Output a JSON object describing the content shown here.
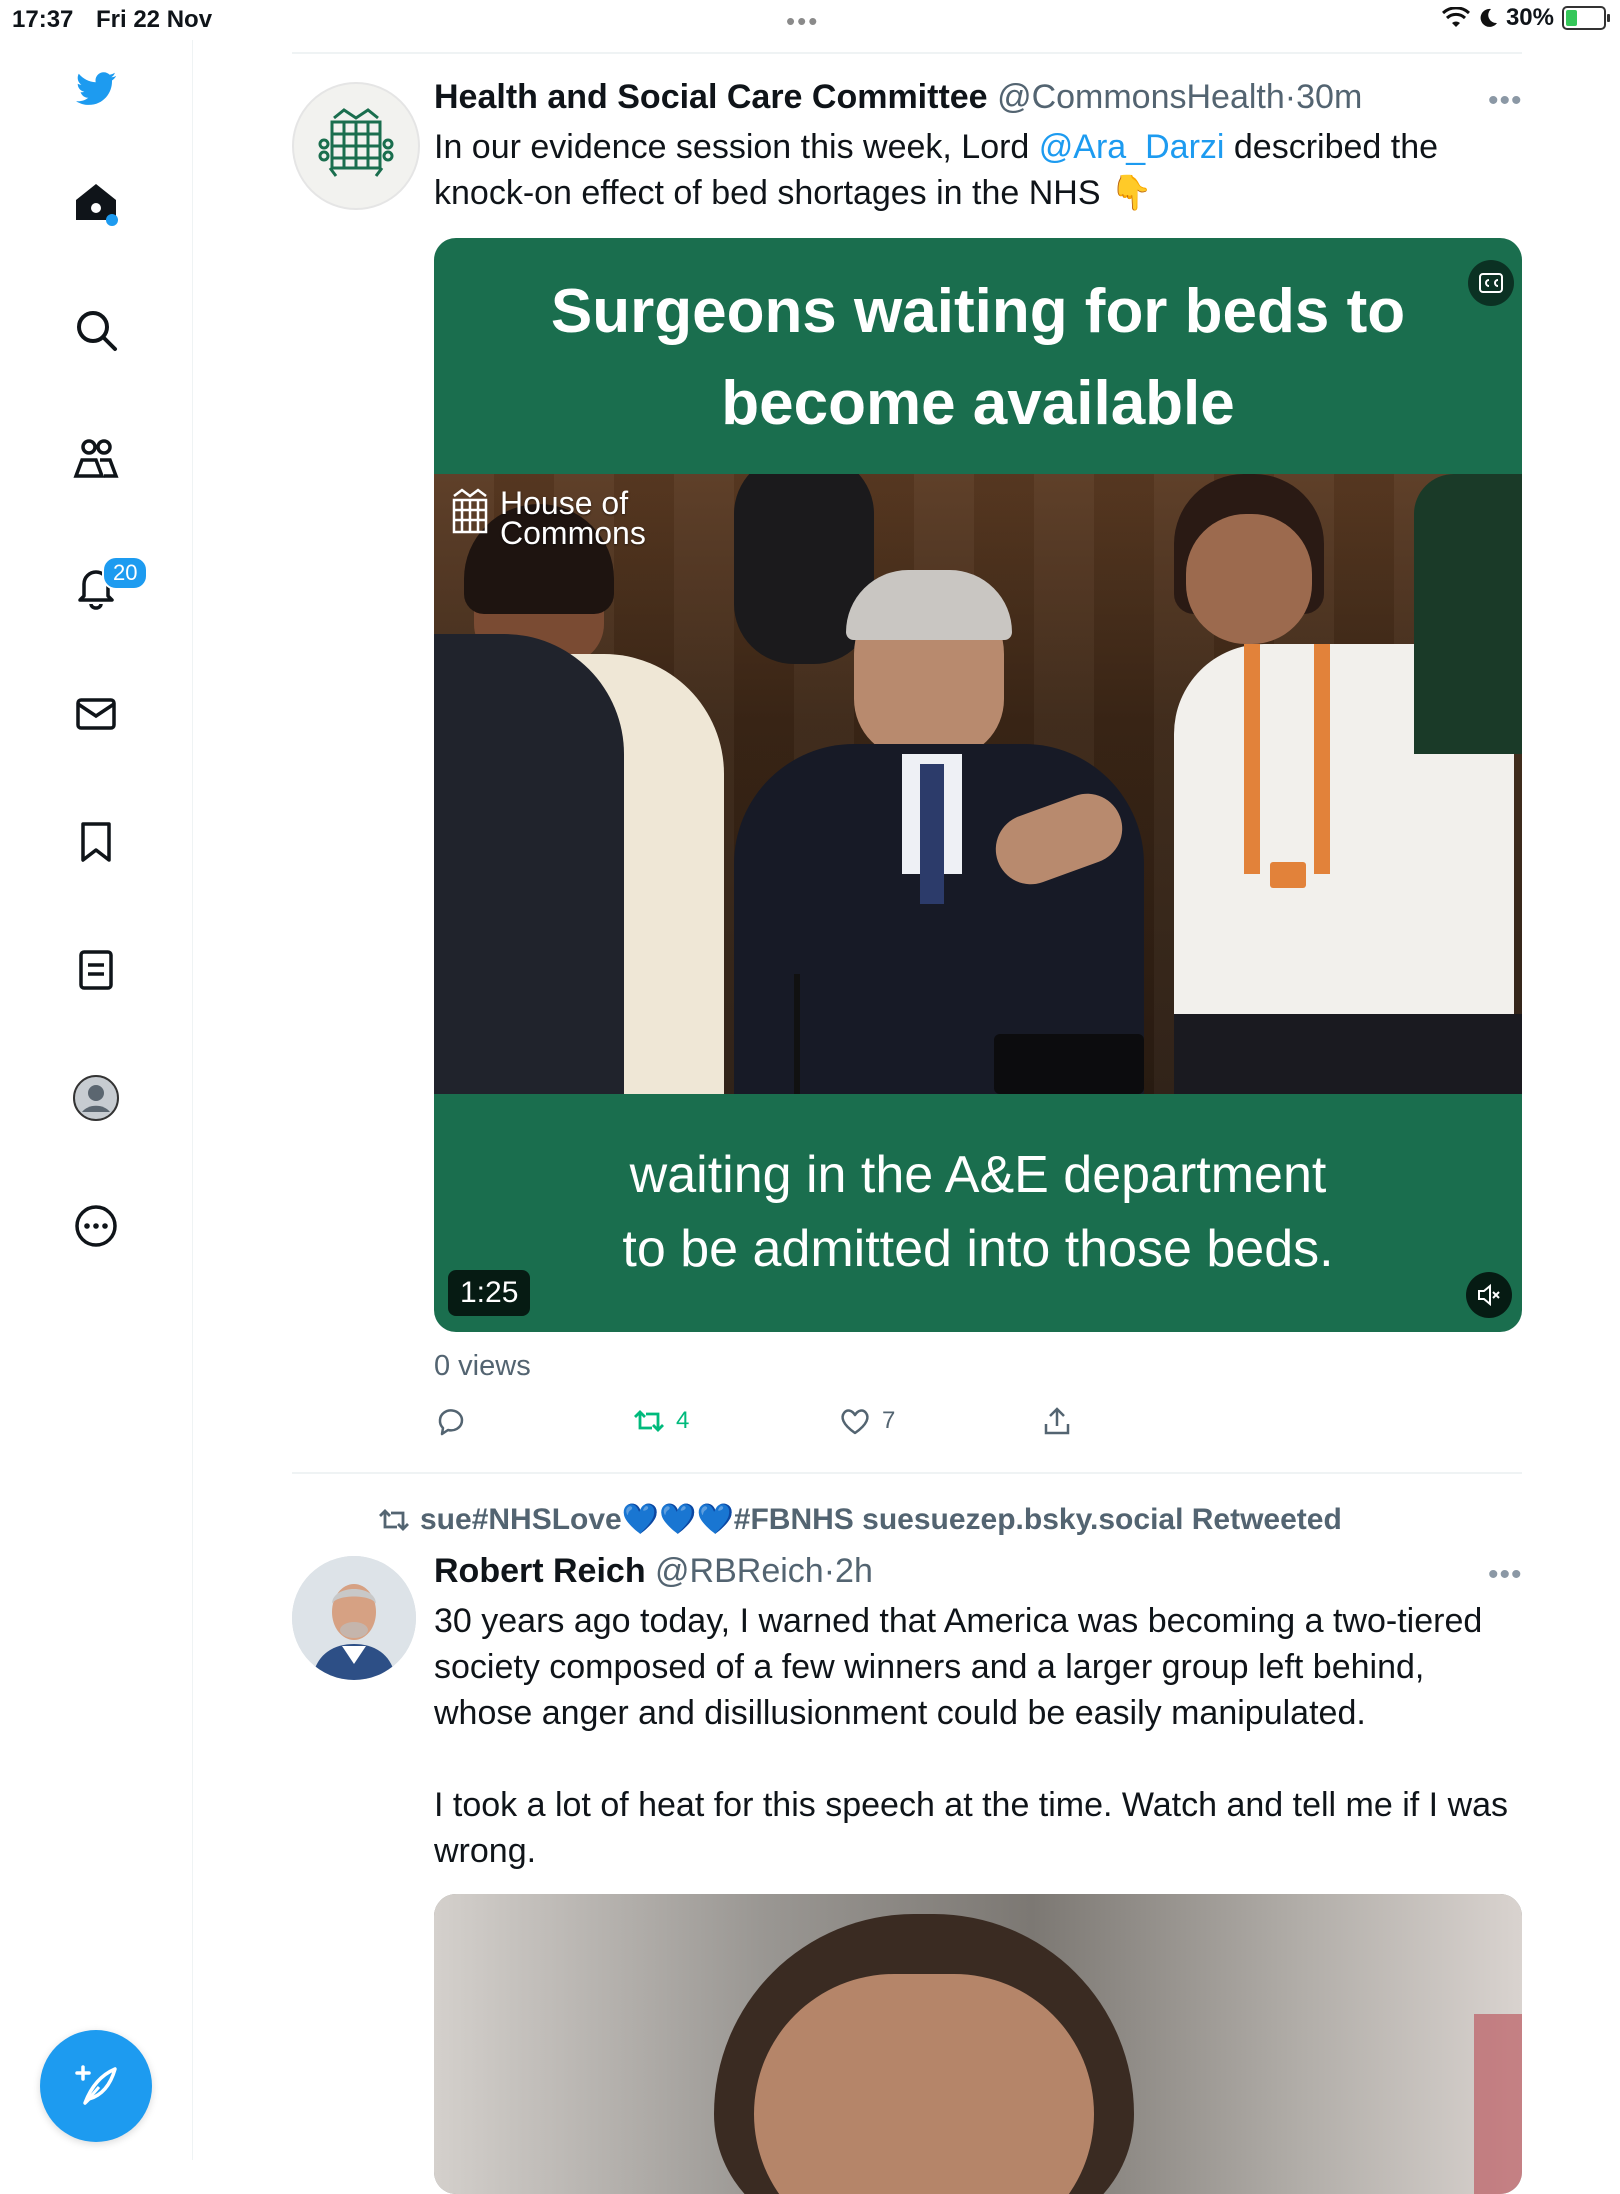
{
  "status_bar": {
    "time": "17:37",
    "date": "Fri 22 Nov",
    "dots": "•••",
    "battery": "30%",
    "battery_level": 0.3
  },
  "sidebar": {
    "notifications_count": "20",
    "items": [
      {
        "icon": "twitter-bird-icon"
      },
      {
        "icon": "home-icon"
      },
      {
        "icon": "search-icon"
      },
      {
        "icon": "communities-icon"
      },
      {
        "icon": "notifications-bell-icon"
      },
      {
        "icon": "messages-envelope-icon"
      },
      {
        "icon": "bookmark-icon"
      },
      {
        "icon": "lists-icon"
      },
      {
        "icon": "profile-avatar-icon"
      },
      {
        "icon": "more-circle-icon"
      }
    ],
    "compose_icon": "compose-feather-icon"
  },
  "tweets": [
    {
      "name": "Health and Social Care Committee",
      "handle": "@CommonsHealth",
      "sep": "·",
      "time": "30m",
      "more": "•••",
      "text_before": "In our evidence session this week, Lord ",
      "mention": "@Ara_Darzi",
      "text_after": "  described the knock-on effect of bed shortages in the NHS ",
      "emoji": "👇",
      "video": {
        "caption_top": "Surgeons waiting for beds to become available",
        "watermark_line1": "House of",
        "watermark_line2": "Commons",
        "caption_bottom_line1": "waiting in the A&E department",
        "caption_bottom_line2": "to be admitted into those beds.",
        "duration": "1:25"
      },
      "views": "0 views",
      "retweets": "4",
      "likes": "7",
      "accent": "#1a6e4e"
    },
    {
      "retweeted_by": "sue#NHSLove💙💙💙#FBNHS suesuezep.bsky.social Retweeted",
      "name": "Robert Reich",
      "handle": "@RBReich",
      "sep": "·",
      "time": "2h",
      "more": "•••",
      "para1": "30 years ago today, I warned that America was becoming a two-tiered society composed of a few winners and a larger group left behind, whose anger and disillusionment could be easily manipulated.",
      "para2": "I took a lot of heat for this speech at the time. Watch and tell me if I was wrong."
    }
  ],
  "colors": {
    "brand": "#1d9bf0",
    "retweet_green": "#00ba7c",
    "video_green": "#1a6e4e"
  }
}
